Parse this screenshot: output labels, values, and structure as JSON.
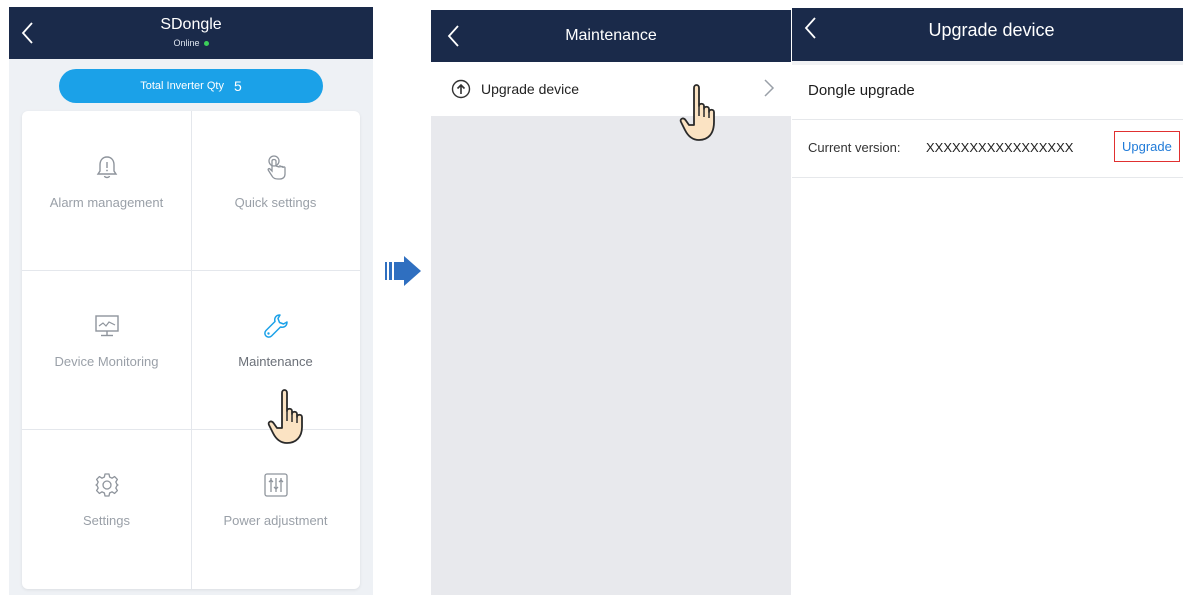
{
  "screen1": {
    "title": "SDongle",
    "status": "Online",
    "total_inverter_label": "Total Inverter Qty",
    "total_inverter_count": "5",
    "tiles": [
      {
        "label": "Alarm management",
        "icon": "alarm-bell-icon"
      },
      {
        "label": "Quick settings",
        "icon": "touch-icon"
      },
      {
        "label": "Device Monitoring",
        "icon": "monitor-icon"
      },
      {
        "label": "Maintenance",
        "icon": "wrench-icon"
      },
      {
        "label": "Settings",
        "icon": "gear-icon"
      },
      {
        "label": "Power adjustment",
        "icon": "sliders-icon"
      }
    ],
    "colors": {
      "header": "#1a2a4a",
      "pill": "#1ba1e8",
      "status_dot": "#3ccf5a",
      "accent_icon": "#1ba1e8"
    }
  },
  "arrow_icon": "right-arrow-icon",
  "screen2": {
    "title": "Maintenance",
    "row_label": "Upgrade device",
    "row_icon": "upload-circle-icon"
  },
  "screen3": {
    "title": "Upgrade device",
    "section_title": "Dongle upgrade",
    "version_label": "Current version:",
    "version_value": "XXXXXXXXXXXXXXXXX",
    "upgrade_label": "Upgrade",
    "colors": {
      "upgrade_text": "#1f7ad8",
      "highlight_border": "#e03030"
    }
  }
}
